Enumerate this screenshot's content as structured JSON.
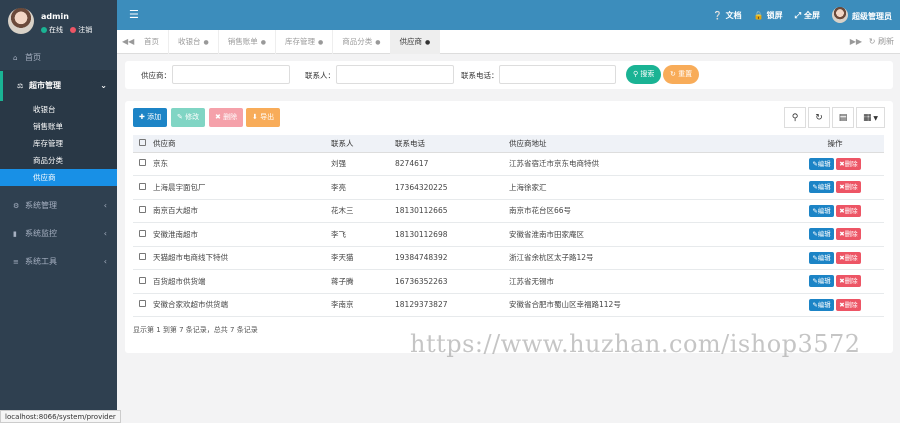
{
  "user": {
    "name": "admin",
    "status_online": "在线",
    "status_logout": "注销"
  },
  "sidebar": {
    "home": "首页",
    "group": "超市管理",
    "sub_items": [
      "收银台",
      "销售账单",
      "库存管理",
      "商品分类",
      "供应商"
    ],
    "others": [
      "系统管理",
      "系统监控",
      "系统工具"
    ]
  },
  "header": {
    "doc": "文档",
    "lock": "锁屏",
    "full": "全屏",
    "admin": "超级管理员"
  },
  "tabs": {
    "items": [
      "首页",
      "收银台",
      "销售账单",
      "库存管理",
      "商品分类",
      "供应商"
    ],
    "refresh": "刷新"
  },
  "search": {
    "supplier_label": "供应商：",
    "contact_label": "联系人：",
    "phone_label": "联系电话：",
    "search_btn": "搜索",
    "reset_btn": "重置"
  },
  "toolbar": {
    "add": "添加",
    "edit": "修改",
    "delete": "删除",
    "export": "导出"
  },
  "table": {
    "headers": [
      "供应商",
      "联系人",
      "联系电话",
      "供应商地址",
      "操作"
    ],
    "rows": [
      {
        "name": "京东",
        "contact": "刘强",
        "phone": "8274617",
        "address": "江苏省宿迁市京东电商特供"
      },
      {
        "name": "上海晨宇面包厂",
        "contact": "李亮",
        "phone": "17364320225",
        "address": "上海徐家汇"
      },
      {
        "name": "南京百大超市",
        "contact": "花木三",
        "phone": "18130112665",
        "address": "南京市花台区66号"
      },
      {
        "name": "安徽淮南超市",
        "contact": "李飞",
        "phone": "18130112698",
        "address": "安徽省淮南市田家庵区"
      },
      {
        "name": "天猫超市电商线下特供",
        "contact": "李天猫",
        "phone": "19384748392",
        "address": "浙江省余杭区太子路12号"
      },
      {
        "name": "百货超市供货端",
        "contact": "蒋子腾",
        "phone": "16736352263",
        "address": "江苏省无锡市"
      },
      {
        "name": "安徽合家欢超市供货端",
        "contact": "李南京",
        "phone": "18129373827",
        "address": "安徽省合肥市蜀山区幸福路112号"
      }
    ],
    "edit_label": "编辑",
    "delete_label": "删除"
  },
  "pagination": "显示第 1 到第 7 条记录，总共 7 条记录",
  "status_url": "localhost:8066/system/provider",
  "watermark": "https://www.huzhan.com/ishop3572",
  "colors": {
    "sidebar": "#2f4050",
    "header": "#3c8dbc",
    "active": "#1890e6",
    "add": "#1c84c6",
    "edit": "#1ab394",
    "delete": "#ed5565",
    "export": "#f8ac59"
  }
}
